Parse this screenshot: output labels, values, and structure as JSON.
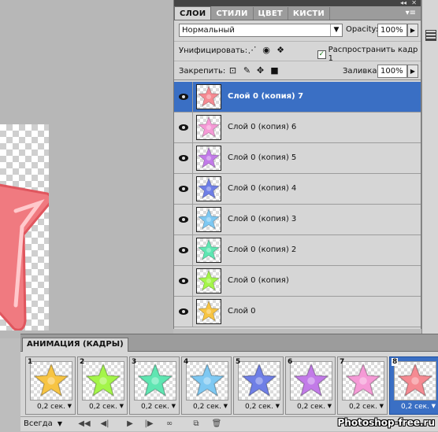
{
  "layers_panel": {
    "tabs": [
      "СЛОИ",
      "СТИЛИ",
      "ЦВЕТ",
      "КИСТИ"
    ],
    "active_tab": "СЛОИ",
    "blend_mode": "Нормальный",
    "opacity_label": "Opacity:",
    "opacity_value": "100%",
    "unify_label": "Унифицировать:",
    "propagate_label": "Распространить кадр 1",
    "propagate_checked": true,
    "lock_label": "Закрепить:",
    "fill_label": "Заливка:",
    "fill_value": "100%",
    "layers": [
      {
        "name": "Слой 0 (копия) 7",
        "color": "#f58a92",
        "active": true
      },
      {
        "name": "Слой 0 (копия) 6",
        "color": "#f59ad6",
        "active": false
      },
      {
        "name": "Слой 0 (копия) 5",
        "color": "#c27be8",
        "active": false
      },
      {
        "name": "Слой 0 (копия) 4",
        "color": "#6f7fe6",
        "active": false
      },
      {
        "name": "Слой 0 (копия) 3",
        "color": "#7ec8f2",
        "active": false
      },
      {
        "name": "Слой 0 (копия) 2",
        "color": "#5fe6b2",
        "active": false
      },
      {
        "name": "Слой 0 (копия)",
        "color": "#a4f54a",
        "active": false
      },
      {
        "name": "Слой 0",
        "color": "#f7c443",
        "active": false
      }
    ]
  },
  "animation_panel": {
    "title": "АНИМАЦИЯ (КАДРЫ)",
    "loop_label": "Всегда",
    "frames": [
      {
        "num": "1",
        "color": "#f7c443",
        "delay": "0,2 сек."
      },
      {
        "num": "2",
        "color": "#a4f54a",
        "delay": "0,2 сек."
      },
      {
        "num": "3",
        "color": "#5fe6b2",
        "delay": "0,2 сек."
      },
      {
        "num": "4",
        "color": "#7ec8f2",
        "delay": "0,2 сек."
      },
      {
        "num": "5",
        "color": "#6f7fe6",
        "delay": "0,2 сек."
      },
      {
        "num": "6",
        "color": "#c27be8",
        "delay": "0,2 сек."
      },
      {
        "num": "7",
        "color": "#f59ad6",
        "delay": "0,2 сек."
      },
      {
        "num": "8",
        "color": "#f58a92",
        "delay": "0,2 сек."
      }
    ],
    "selected_frame": "8"
  },
  "watermark": "Photoshop-free.ru",
  "canvas_star_color": "#f07a80",
  "selection_color": "#3a6fc4"
}
